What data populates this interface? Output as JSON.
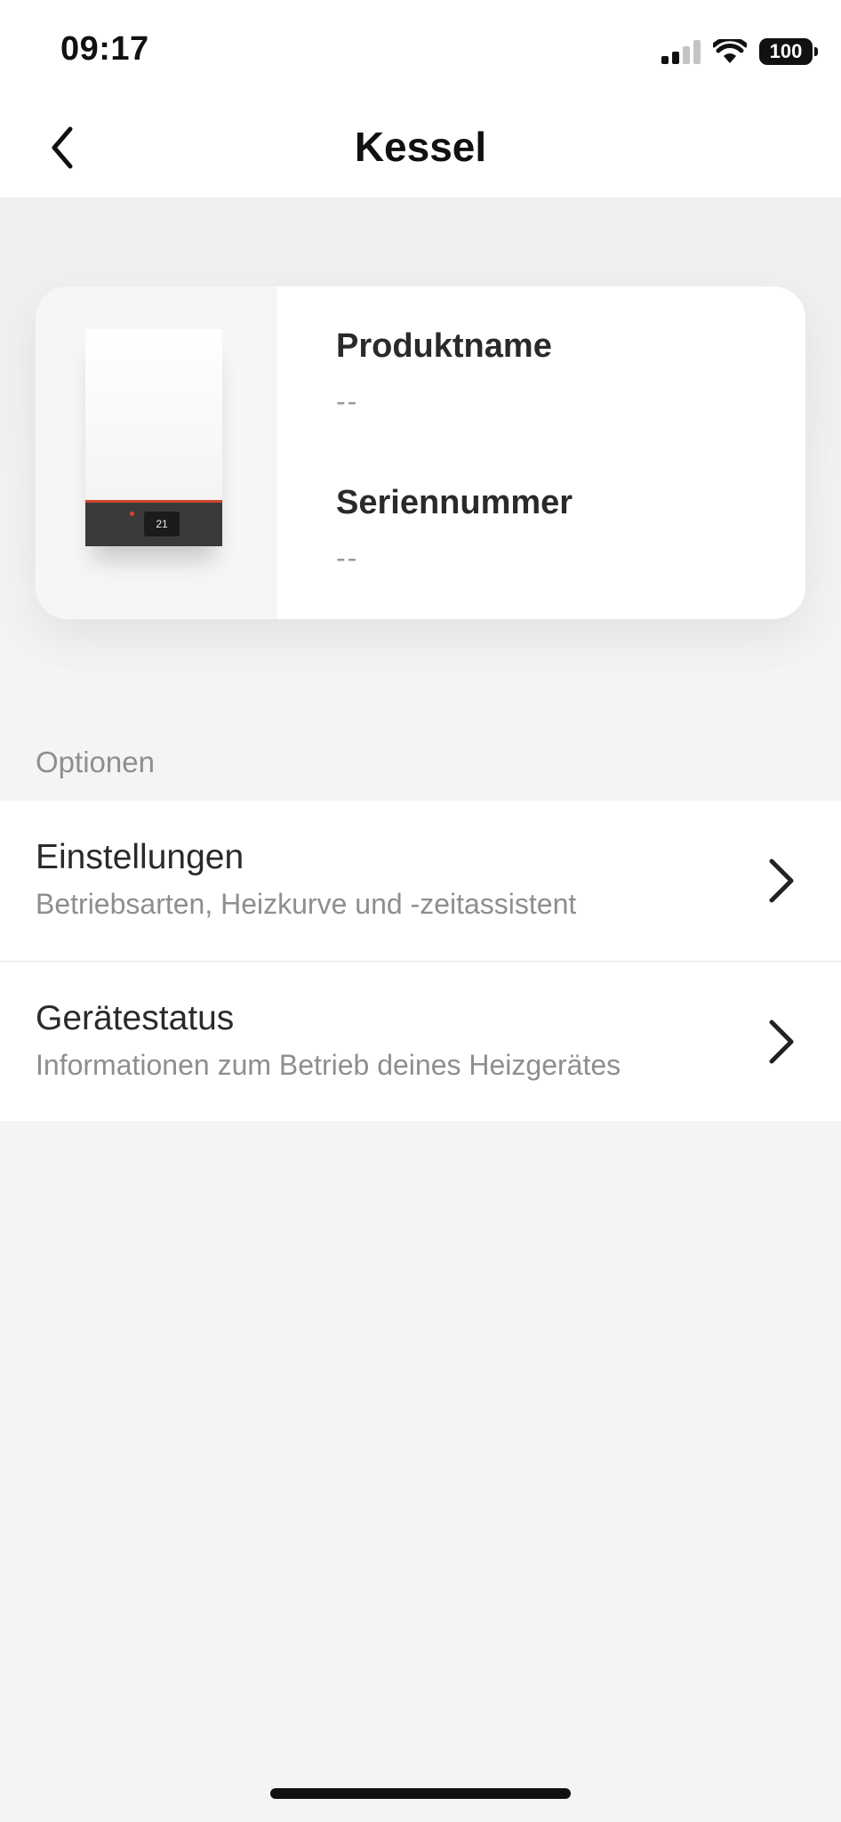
{
  "status_bar": {
    "time": "09:17",
    "battery": "100"
  },
  "nav": {
    "title": "Kessel"
  },
  "device": {
    "boiler_display": "21",
    "product_name_label": "Produktname",
    "product_name_value": "--",
    "serial_label": "Seriennummer",
    "serial_value": "--"
  },
  "options": {
    "section_label": "Optionen",
    "items": [
      {
        "title": "Einstellungen",
        "subtitle": "Betriebsarten, Heizkurve und -zeitassistent"
      },
      {
        "title": "Gerätestatus",
        "subtitle": "Informationen zum Betrieb deines Heizgerätes"
      }
    ]
  }
}
